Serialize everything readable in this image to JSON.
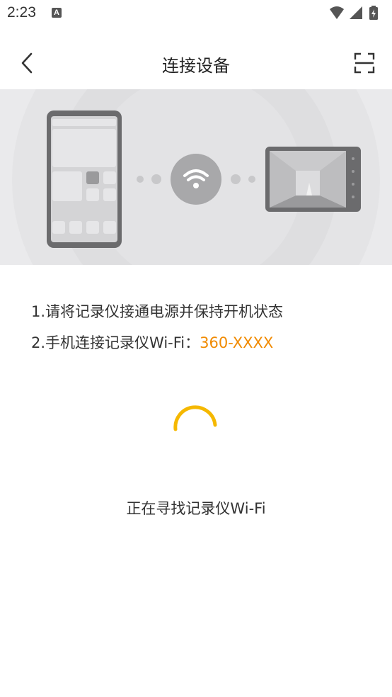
{
  "status_bar": {
    "time": "2:23",
    "notification_icon": "A"
  },
  "header": {
    "title": "连接设备"
  },
  "instructions": {
    "line1": "1.请将记录仪接通电源并保持开机状态",
    "line2_prefix": "2.手机连接记录仪Wi-Fi：",
    "ssid": "360-XXXX"
  },
  "status": {
    "searching": "正在寻找记录仪Wi-Fi"
  },
  "colors": {
    "accent": "#f08a00",
    "spinner": "#f5b800",
    "banner_bg": "#eaeaec"
  },
  "icons": {
    "back": "chevron-left-icon",
    "scan": "scan-icon",
    "wifi": "wifi-icon",
    "phone": "phone-icon",
    "dashcam": "dashcam-icon"
  }
}
